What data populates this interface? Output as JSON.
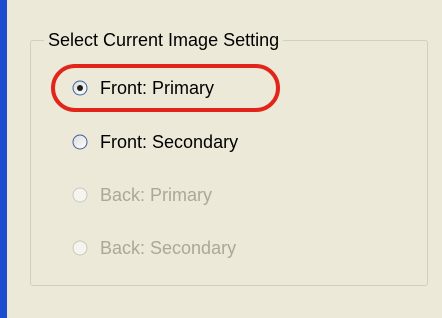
{
  "group": {
    "title": "Select Current Image Setting"
  },
  "options": [
    {
      "label": "Front: Primary",
      "selected": true,
      "enabled": true
    },
    {
      "label": "Front: Secondary",
      "selected": false,
      "enabled": true
    },
    {
      "label": "Back: Primary",
      "selected": false,
      "enabled": false
    },
    {
      "label": "Back: Secondary",
      "selected": false,
      "enabled": false
    }
  ],
  "icons": {
    "radio": "radio-button-icon"
  },
  "colors": {
    "window_background": "#ece9d8",
    "left_edge": "#1a4ecf",
    "highlight": "#e1251b",
    "disabled_text": "#aca899",
    "enabled_text": "#000000"
  }
}
